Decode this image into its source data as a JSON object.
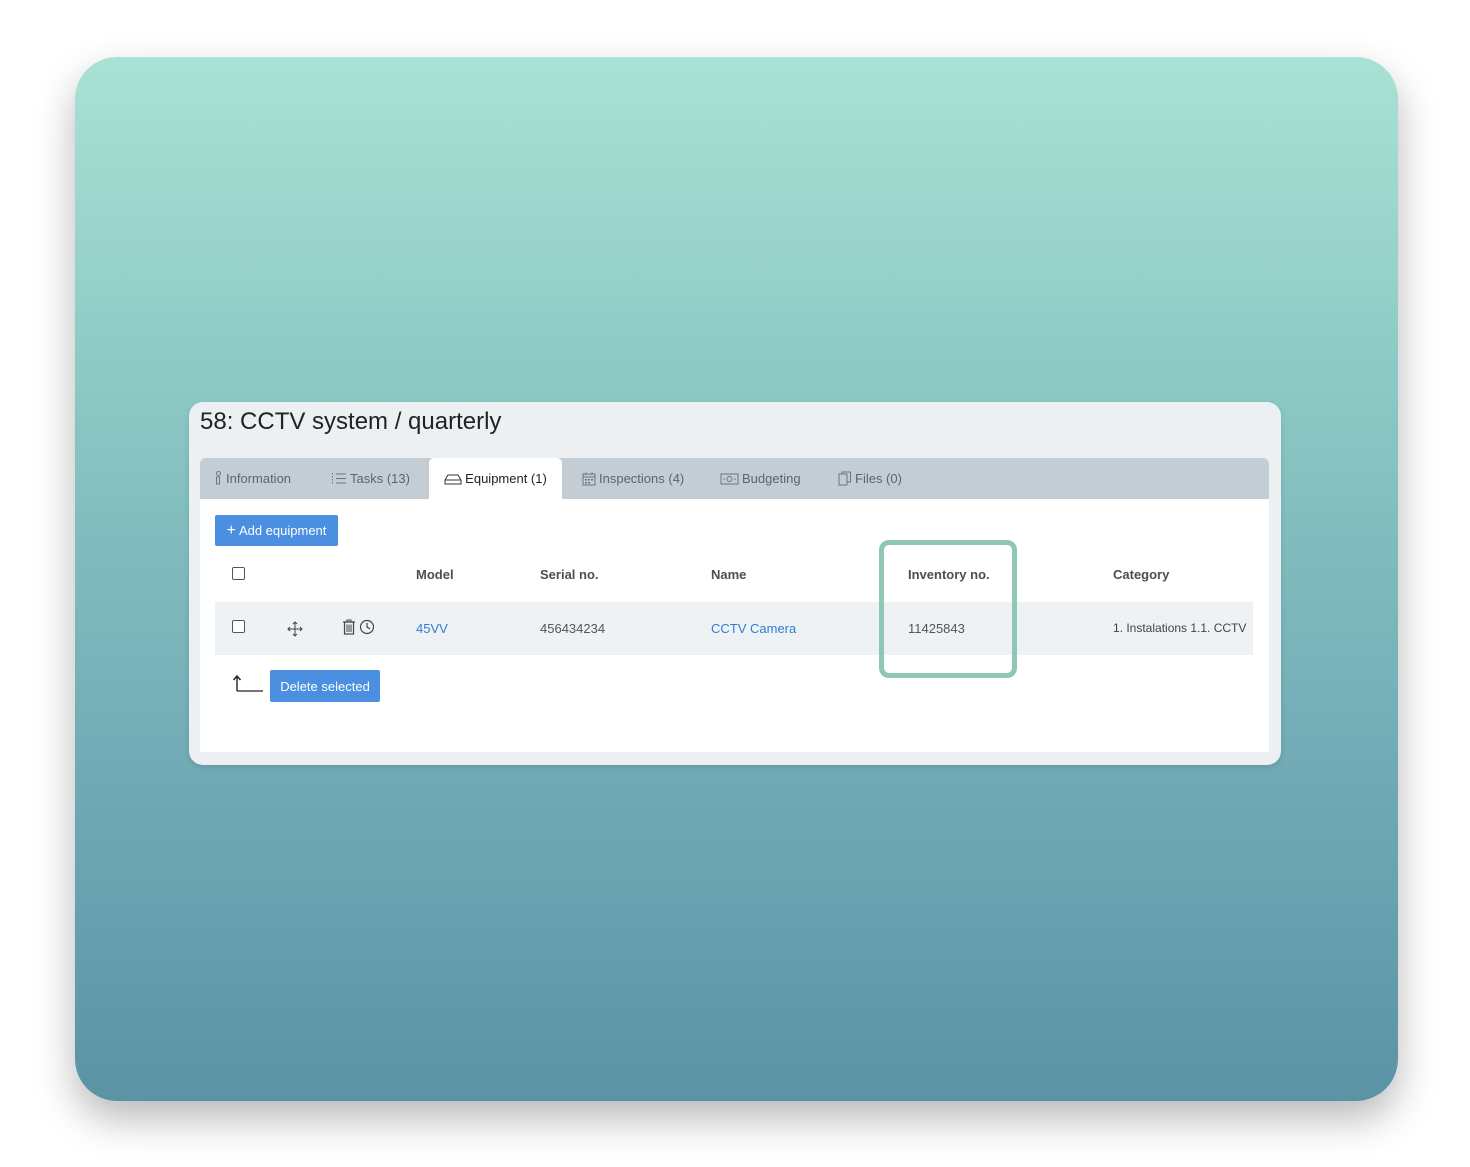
{
  "window": {
    "title": "58: CCTV system / quarterly"
  },
  "tabs": [
    {
      "label": "Information",
      "icon": "info-icon"
    },
    {
      "label": "Tasks (13)",
      "icon": "list-icon"
    },
    {
      "label": "Equipment (1)",
      "icon": "equipment-icon",
      "active": true
    },
    {
      "label": "Inspections (4)",
      "icon": "calendar-icon"
    },
    {
      "label": "Budgeting",
      "icon": "money-icon"
    },
    {
      "label": "Files (0)",
      "icon": "files-icon"
    }
  ],
  "toolbar": {
    "add_equipment_label": "Add equipment",
    "delete_selected_label": "Delete selected"
  },
  "table": {
    "headers": {
      "model": "Model",
      "serial": "Serial no.",
      "name": "Name",
      "inventory": "Inventory no.",
      "category": "Category"
    },
    "rows": [
      {
        "model": "45VV",
        "serial": "456434234",
        "name": "CCTV Camera",
        "inventory": "11425843",
        "category": "1. Instalations 1.1. CCTV"
      }
    ]
  },
  "colors": {
    "accent": "#4a8fe0",
    "link": "#2f7fd0",
    "highlight": "#8ec7b5"
  }
}
